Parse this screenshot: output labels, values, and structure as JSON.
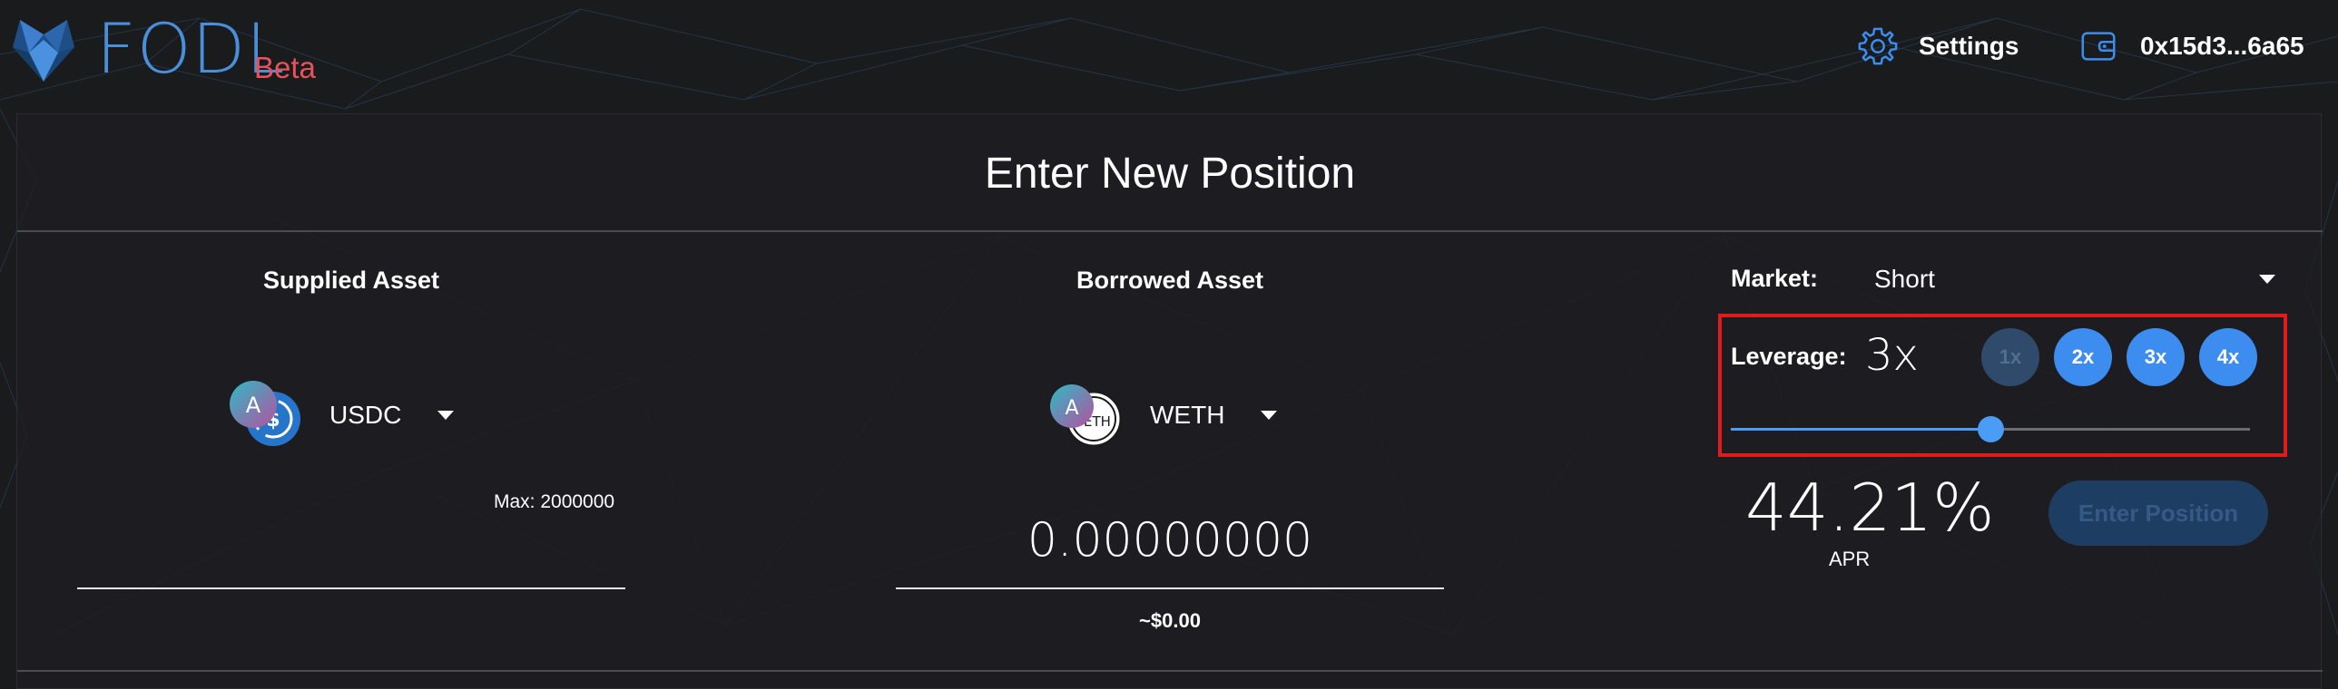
{
  "header": {
    "brand": "FODL",
    "badge": "Beta",
    "settings_label": "Settings",
    "wallet_address": "0x15d3...6a65",
    "icons": {
      "logo": "fox-logo-icon",
      "settings": "gear-icon",
      "wallet": "wallet-icon"
    }
  },
  "panel": {
    "title": "Enter New Position",
    "supplied": {
      "title": "Supplied Asset",
      "asset": "USDC",
      "max_label": "Max: 2000000",
      "amount": ""
    },
    "borrowed": {
      "title": "Borrowed Asset",
      "asset": "WETH",
      "amount": "0.00000000",
      "usd_value": "~$0.00"
    },
    "market": {
      "label": "Market:",
      "value": "Short"
    },
    "leverage": {
      "label": "Leverage:",
      "value": "3x",
      "level": 3,
      "range": [
        1,
        5
      ],
      "presets": [
        "1x",
        "2x",
        "3x",
        "4x"
      ]
    },
    "apr": {
      "value": "44.21%",
      "label": "APR"
    },
    "enter_button": "Enter Position"
  },
  "colors": {
    "accent": "#3d8cef",
    "brand": "#4a8fd9",
    "beta": "#e7535d",
    "highlight": "#e01b1b",
    "background": "#1a1b1d"
  }
}
